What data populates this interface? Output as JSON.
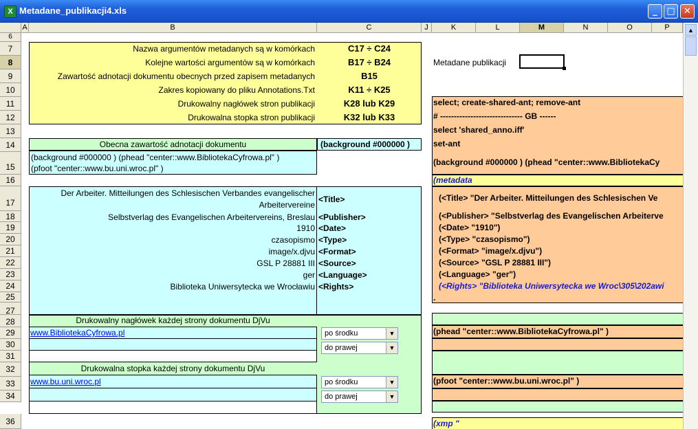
{
  "window": {
    "title": "Metadane_publikacji4.xls",
    "app_icon": "excel-icon",
    "minimize": "_",
    "maximize": "□",
    "close": "✕"
  },
  "columns": [
    "A",
    "B",
    "C",
    "J",
    "K",
    "L",
    "M",
    "N",
    "O",
    "P"
  ],
  "rows": [
    "6",
    "7",
    "8",
    "9",
    "10",
    "11",
    "12",
    "13",
    "14",
    "15",
    "16",
    "17",
    "18",
    "19",
    "20",
    "21",
    "22",
    "23",
    "24",
    "25",
    "27",
    "28",
    "29",
    "30",
    "31",
    "32",
    "33",
    "34",
    "36"
  ],
  "info": [
    {
      "label": "Nazwa argumentów metadanych są w komórkach",
      "value": "C17 ÷ C24"
    },
    {
      "label": "Kolejne wartości argumentów są w komórkach",
      "value": "B17 ÷ B24"
    },
    {
      "label": "Zawartość adnotacji dokumentu obecnych przed zapisem metadanych",
      "value": "B15"
    },
    {
      "label": "Zakres kopiowany do pliku Annotations.Txt",
      "value": "K11 ÷ K25"
    },
    {
      "label": "Drukowalny nagłówek stron publikacji",
      "value": "K28 lub K29"
    },
    {
      "label": "Drukowalna stopka stron publikacji",
      "value": "K32 lub K33"
    }
  ],
  "metadane_label": "Metadane publikacji",
  "current": {
    "header": "Obecna zawartość adnotacji dokumentu",
    "bg": "(background #000000 )",
    "line1": "(background #000000 ) (phead \"center::www.BibliotekaCyfrowa.pl\" )",
    "line2": "(pfoot \"center::www.bu.uni.wroc.pl\" )"
  },
  "meta_rows": [
    {
      "value": "Der Arbeiter. Mitteilungen des Schlesischen Verbandes evangelischer",
      "value2": "Arbeitervereine",
      "tag": "<Title>"
    },
    {
      "value": "Selbstverlag des Evangelischen Arbeitervereins, Breslau",
      "tag": "<Publisher>"
    },
    {
      "value": "1910",
      "tag": "<Date>"
    },
    {
      "value": "czasopismo",
      "tag": "<Type>"
    },
    {
      "value": "image/x.djvu",
      "tag": "<Format>"
    },
    {
      "value": "GSL P 28881 III",
      "tag": "<Source>"
    },
    {
      "value": "ger",
      "tag": "<Language>"
    },
    {
      "value": "Biblioteka Uniwersytecka we Wrocławiu",
      "tag": "<Rights>"
    }
  ],
  "header_section": {
    "title": "Drukowalny nagłówek każdej strony dokumentu DjVu",
    "link": "www.BibliotekaCyfrowa.pl",
    "dd1": "po środku",
    "dd2": "do prawej"
  },
  "footer_section": {
    "title": "Drukowalna stopka każdej strony dokumentu DjVu",
    "link": "www.bu.uni.wroc.pl",
    "dd1": "po środku",
    "dd2": "do prawej"
  },
  "code": {
    "l1": "select; create-shared-ant; remove-ant",
    "l2": "# ------------------------------ GB ------",
    "l3": "select 'shared_anno.iff'",
    "l4": "set-ant",
    "l5": "(background #000000 ) (phead \"center::www.BibliotekaCy",
    "meta": "(metadata",
    "m1": "(<Title> \"Der Arbeiter. Mitteilungen des Schlesischen Ve",
    "m2": "(<Publisher> \"Selbstverlag des Evangelischen Arbeiterve",
    "m3": "(<Date> \"1910\")",
    "m4": "(<Type> \"czasopismo\")",
    "m5": "(<Format> \"image/x.djvu\")",
    "m6": "(<Source> \"GSL P 28881 III\")",
    "m7": "(<Language> \"ger\")",
    "m8": "(<Rights> \"Biblioteka Uniwersytecka we Wroc\\305\\202awi",
    "dot": ".",
    "phead": "(phead \"center::www.BibliotekaCyfrowa.pl\" )",
    "pfoot": "(pfoot \"center::www.bu.uni.wroc.pl\" )",
    "xmp": "(xmp \""
  },
  "colors": {
    "yellow": "#ffff99",
    "cyan": "#ccffff",
    "green": "#ccffcc",
    "orange": "#ffcc99"
  }
}
